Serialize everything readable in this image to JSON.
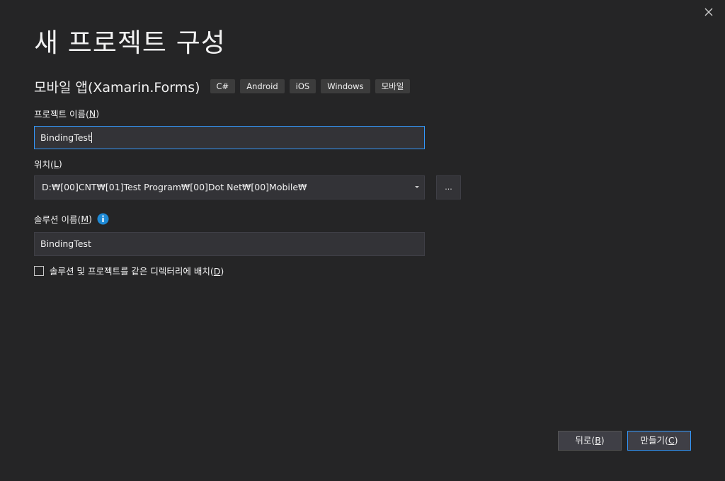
{
  "dialog": {
    "title": "새 프로젝트 구성",
    "close_icon": "close-icon"
  },
  "template": {
    "name": "모바일 앱(Xamarin.Forms)",
    "tags": [
      "C#",
      "Android",
      "iOS",
      "Windows",
      "모바일"
    ]
  },
  "project_name": {
    "label": "프로젝트 이름(",
    "accel": "N",
    "label_end": ")",
    "value": "BindingTest"
  },
  "location": {
    "label": "위치(",
    "accel": "L",
    "label_end": ")",
    "value": "D:₩[00]CNT₩[01]Test Program₩[00]Dot Net₩[00]Mobile₩",
    "browse_label": "..."
  },
  "solution_name": {
    "label": "솔루션 이름(",
    "accel": "M",
    "label_end": ")",
    "value": "BindingTest",
    "info_icon": "info-icon"
  },
  "same_directory": {
    "label": "솔루션 및 프로젝트를 같은 디렉터리에 배치(",
    "accel": "D",
    "label_end": ")",
    "checked": false
  },
  "buttons": {
    "back": {
      "label": "뒤로(",
      "accel": "B",
      "label_end": ")"
    },
    "create": {
      "label": "만들기(",
      "accel": "C",
      "label_end": ")"
    }
  },
  "colors": {
    "background": "#252526",
    "input_bg": "#333337",
    "focus_border": "#3399ff",
    "info_blue": "#1e8ad6"
  }
}
